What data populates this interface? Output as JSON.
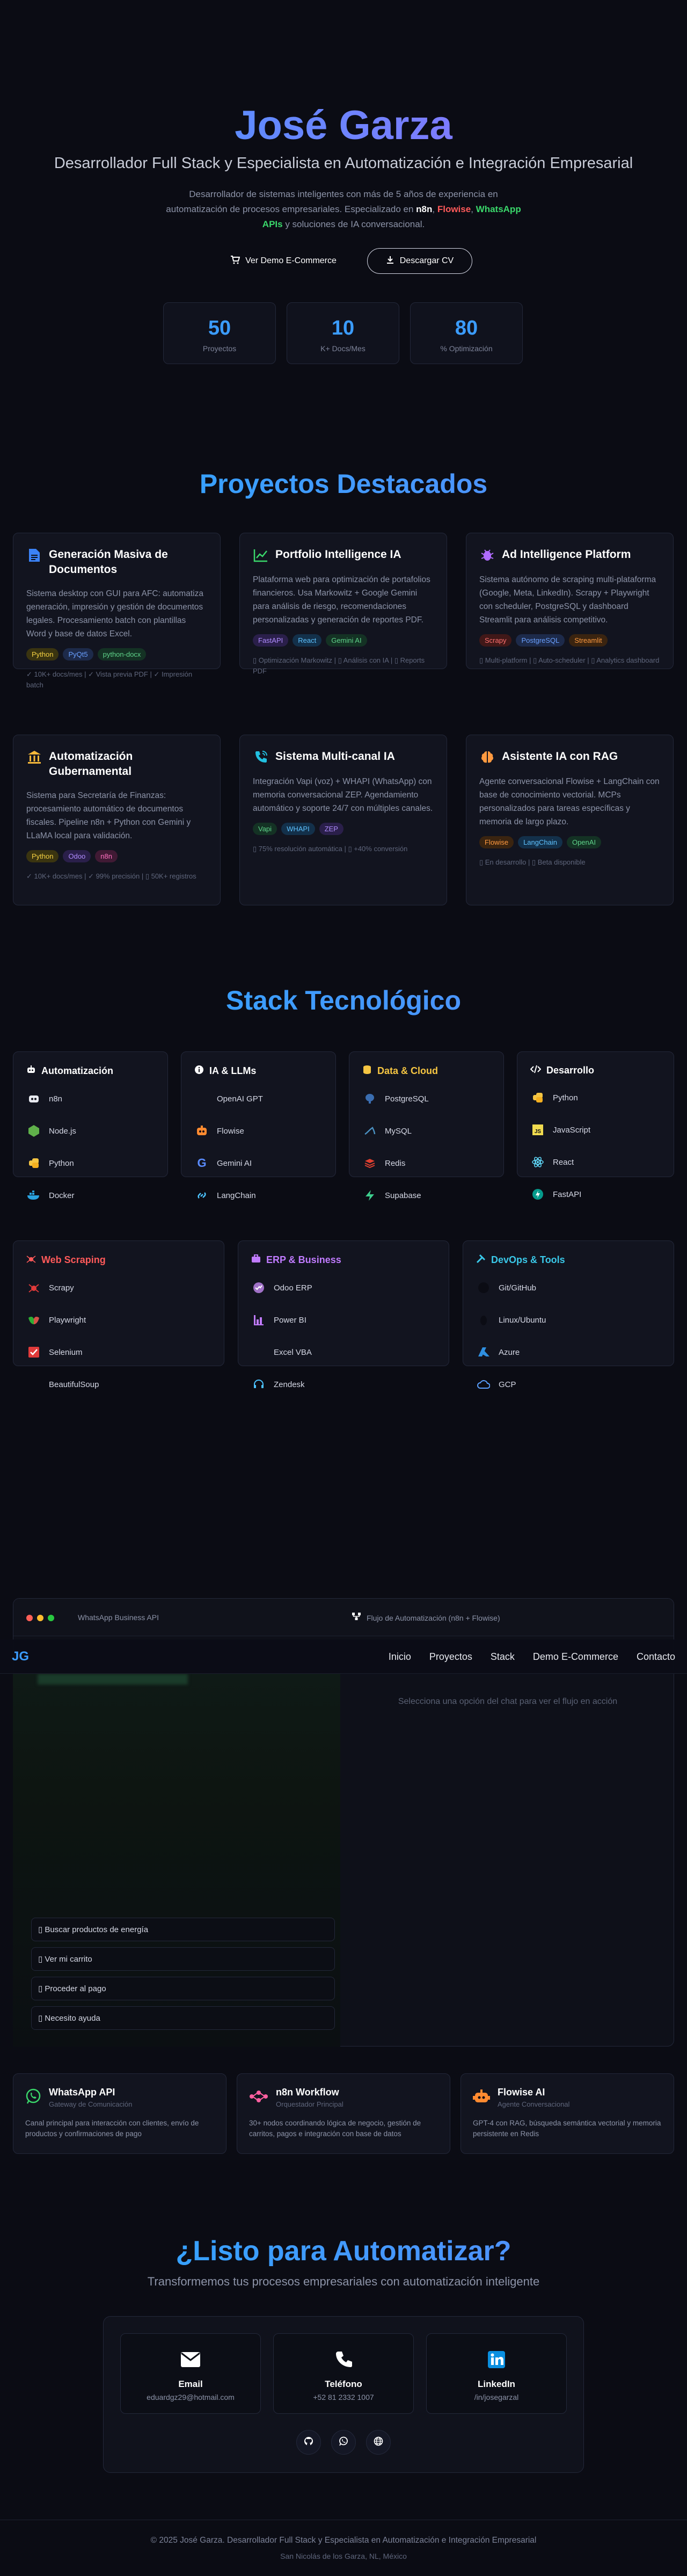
{
  "hero": {
    "name": "José Garza",
    "subtitle": "Desarrollador Full Stack y Especialista en Automatización e Integración Empresarial",
    "desc_1": "Desarrollador de sistemas inteligentes con más de 5 años de experiencia en automatización de procesos empresariales. Especializado en ",
    "desc_n8n": "n8n",
    "desc_sep1": ", ",
    "desc_flowise": "Flowise",
    "desc_sep2": ", ",
    "desc_wa": "WhatsApp APIs",
    "desc_2": " y soluciones de IA conversacional.",
    "btn_demo": "Ver Demo E-Commerce",
    "btn_cv": "Descargar CV",
    "stats": [
      {
        "value": "50",
        "label": "Proyectos"
      },
      {
        "value": "10",
        "label": "K+ Docs/Mes"
      },
      {
        "value": "80",
        "label": "% Optimización"
      }
    ]
  },
  "projects": {
    "title": "Proyectos Destacados",
    "items": [
      {
        "title": "Generación Masiva de Documentos",
        "desc": "Sistema desktop con GUI para AFC: automatiza generación, impresión y gestión de documentos legales. Procesamiento batch con plantillas Word y base de datos Excel.",
        "tags": [
          "Python",
          "PyQt5",
          "python-docx"
        ],
        "meta": "✓ 10K+ docs/mes | ✓ Vista previa PDF | ✓ Impresión batch"
      },
      {
        "title": "Portfolio Intelligence IA",
        "desc": "Plataforma web para optimización de portafolios financieros. Usa Markowitz + Google Gemini para análisis de riesgo, recomendaciones personalizadas y generación de reportes PDF.",
        "tags": [
          "FastAPI",
          "React",
          "Gemini AI"
        ],
        "meta": "▯ Optimización Markowitz | ▯ Análisis con IA | ▯ Reports PDF"
      },
      {
        "title": "Ad Intelligence Platform",
        "desc": "Sistema autónomo de scraping multi-plataforma (Google, Meta, LinkedIn). Scrapy + Playwright con scheduler, PostgreSQL y dashboard Streamlit para análisis competitivo.",
        "tags": [
          "Scrapy",
          "PostgreSQL",
          "Streamlit"
        ],
        "meta": "▯ Multi-platform | ▯ Auto-scheduler | ▯ Analytics dashboard"
      },
      {
        "title": "Automatización Gubernamental",
        "desc": "Sistema para Secretaría de Finanzas: procesamiento automático de documentos fiscales. Pipeline n8n + Python con Gemini y LLaMA local para validación.",
        "tags": [
          "Python",
          "Odoo",
          "n8n"
        ],
        "meta": "✓ 10K+ docs/mes | ✓ 99% precisión | ▯ 50K+ registros"
      },
      {
        "title": "Sistema Multi-canal IA",
        "desc": "Integración Vapi (voz) + WHAPI (WhatsApp) con memoria conversacional ZEP. Agendamiento automático y soporte 24/7 con múltiples canales.",
        "tags": [
          "Vapi",
          "WHAPI",
          "ZEP"
        ],
        "meta": "▯ 75% resolución automática | ▯ +40% conversión"
      },
      {
        "title": "Asistente IA con RAG",
        "desc": "Agente conversacional Flowise + LangChain con base de conocimiento vectorial. MCPs personalizados para tareas específicas y memoria de largo plazo.",
        "tags": [
          "Flowise",
          "LangChain",
          "OpenAI"
        ],
        "meta": "▯ En desarrollo | ▯ Beta disponible"
      }
    ]
  },
  "stack": {
    "title": "Stack Tecnológico",
    "groups": [
      {
        "title": "Automatización",
        "items": [
          "n8n",
          "Node.js",
          "Python",
          "Docker"
        ]
      },
      {
        "title": "IA & LLMs",
        "items": [
          "OpenAI GPT",
          "Flowise",
          "Gemini AI",
          "LangChain"
        ]
      },
      {
        "title": "Data & Cloud",
        "items": [
          "PostgreSQL",
          "MySQL",
          "Redis",
          "Supabase"
        ]
      },
      {
        "title": "Desarrollo",
        "items": [
          "Python",
          "JavaScript",
          "React",
          "FastAPI"
        ]
      },
      {
        "title": "Web Scraping",
        "items": [
          "Scrapy",
          "Playwright",
          "Selenium",
          "BeautifulSoup"
        ]
      },
      {
        "title": "ERP & Business",
        "items": [
          "Odoo ERP",
          "Power BI",
          "Excel VBA",
          "Zendesk"
        ]
      },
      {
        "title": "DevOps & Tools",
        "items": [
          "Git/GitHub",
          "Linux/Ubuntu",
          "Azure",
          "GCP"
        ]
      }
    ]
  },
  "demo": {
    "chat_title": "WhatsApp Business API",
    "flow_title": "Flujo de Automatización (n8n + Flowise)",
    "flow_hint": "Selecciona una opción del chat para ver el flujo en acción",
    "options": [
      "▯ Buscar productos de energía",
      "▯ Ver mi carrito",
      "▯ Proceder al pago",
      "▯ Necesito ayuda"
    ]
  },
  "nav": {
    "logo": "JG",
    "links": [
      "Inicio",
      "Proyectos",
      "Stack",
      "Demo E-Commerce",
      "Contacto"
    ]
  },
  "integrations": [
    {
      "title": "WhatsApp API",
      "subtitle": "Gateway de Comunicación",
      "desc": "Canal principal para interacción con clientes, envío de productos y confirmaciones de pago"
    },
    {
      "title": "n8n Workflow",
      "subtitle": "Orquestador Principal",
      "desc": "30+ nodos coordinando lógica de negocio, gestión de carritos, pagos e integración con base de datos"
    },
    {
      "title": "Flowise AI",
      "subtitle": "Agente Conversacional",
      "desc": "GPT-4 con RAG, búsqueda semántica vectorial y memoria persistente en Redis"
    }
  ],
  "cta": {
    "title": "¿Listo para Automatizar?",
    "subtitle": "Transformemos tus procesos empresariales con automatización inteligente",
    "contacts": [
      {
        "title": "Email",
        "value": "eduardgz29@hotmail.com"
      },
      {
        "title": "Teléfono",
        "value": "+52 81 2332 1007"
      },
      {
        "title": "LinkedIn",
        "value": "/in/josegarzal"
      }
    ]
  },
  "footer": {
    "line1": "© 2025 José Garza. Desarrollador Full Stack y Especialista en Automatización e Integración Empresarial",
    "line2": "San Nicolás de los Garza, NL, México"
  }
}
